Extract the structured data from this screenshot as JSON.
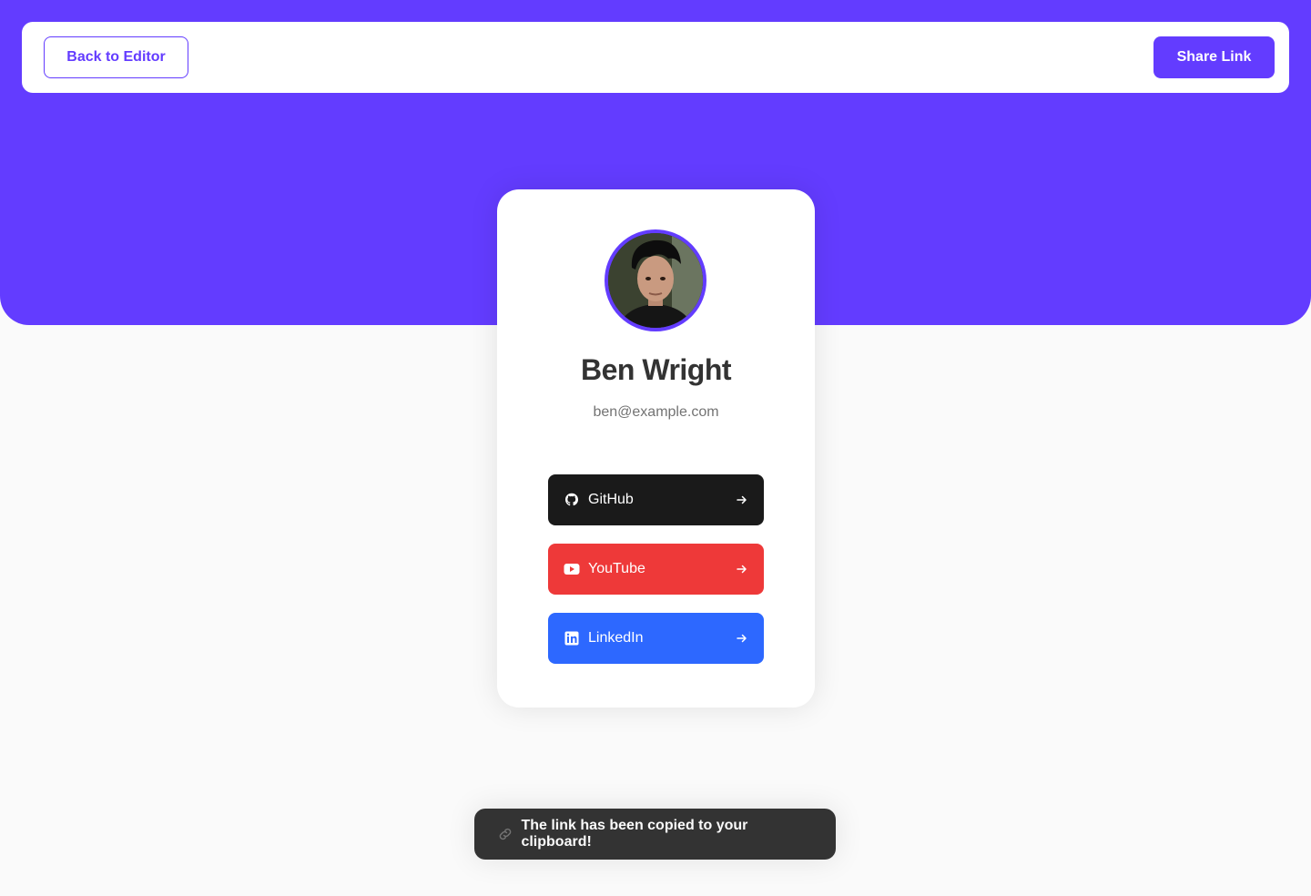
{
  "header": {
    "back_label": "Back to Editor",
    "share_label": "Share Link"
  },
  "profile": {
    "name": "Ben Wright",
    "email": "ben@example.com"
  },
  "links": [
    {
      "platform": "GitHub",
      "color": "#1A1A1A",
      "icon": "github-icon"
    },
    {
      "platform": "YouTube",
      "color": "#EE3939",
      "icon": "youtube-icon"
    },
    {
      "platform": "LinkedIn",
      "color": "#2D68FF",
      "icon": "linkedin-icon"
    }
  ],
  "toast": {
    "message": "The link has been copied to your clipboard!",
    "icon": "link-icon"
  },
  "colors": {
    "brand": "#633CFF",
    "text_dark": "#333333",
    "text_muted": "#737373",
    "background": "#FAFAFA"
  }
}
